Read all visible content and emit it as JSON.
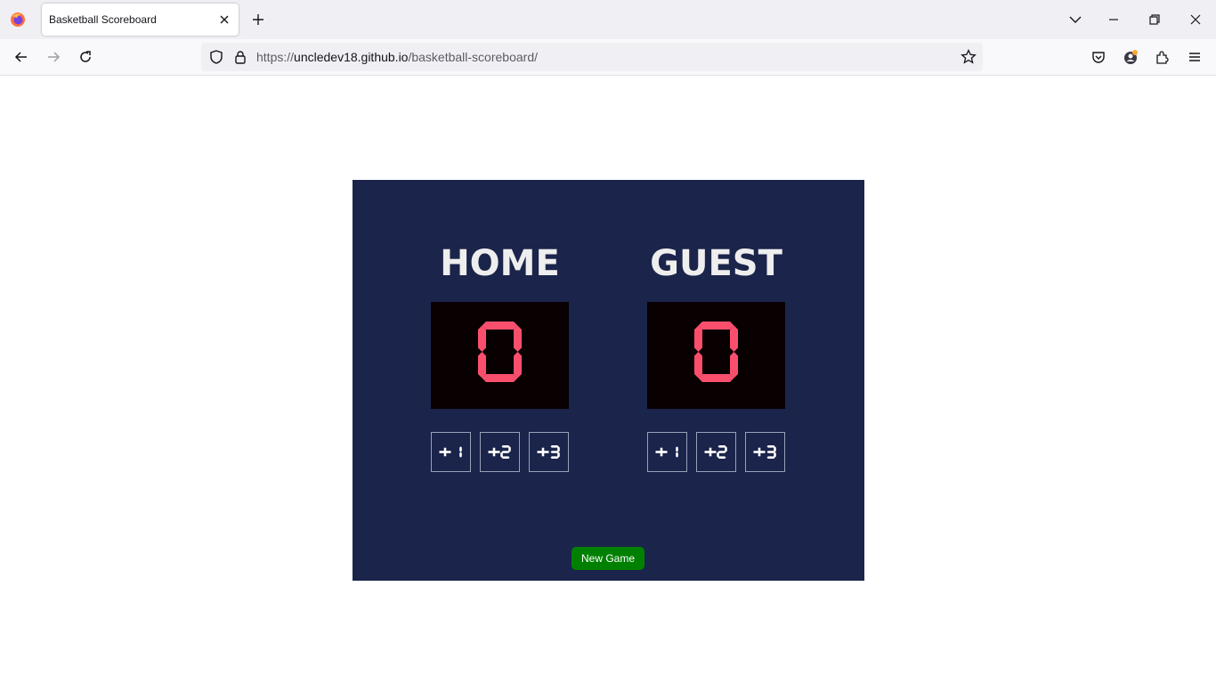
{
  "browser": {
    "tab_title": "Basketball Scoreboard",
    "url_scheme": "https://",
    "url_host": "uncledev18.github.io",
    "url_path": "/basketball-scoreboard/",
    "colors": {
      "tabbar": "#f0f0f4",
      "toolbar": "#f9f9fb"
    }
  },
  "scoreboard": {
    "colors": {
      "panel": "#1b244a",
      "display": "#080001",
      "digit": "#f94f6d",
      "new_game": "#008000"
    },
    "home": {
      "name": "HOME",
      "score": 0,
      "buttons": [
        {
          "label": "+1",
          "value": 1
        },
        {
          "label": "+2",
          "value": 2
        },
        {
          "label": "+3",
          "value": 3
        }
      ]
    },
    "guest": {
      "name": "GUEST",
      "score": 0,
      "buttons": [
        {
          "label": "+1",
          "value": 1
        },
        {
          "label": "+2",
          "value": 2
        },
        {
          "label": "+3",
          "value": 3
        }
      ]
    },
    "new_game_label": "New Game"
  }
}
